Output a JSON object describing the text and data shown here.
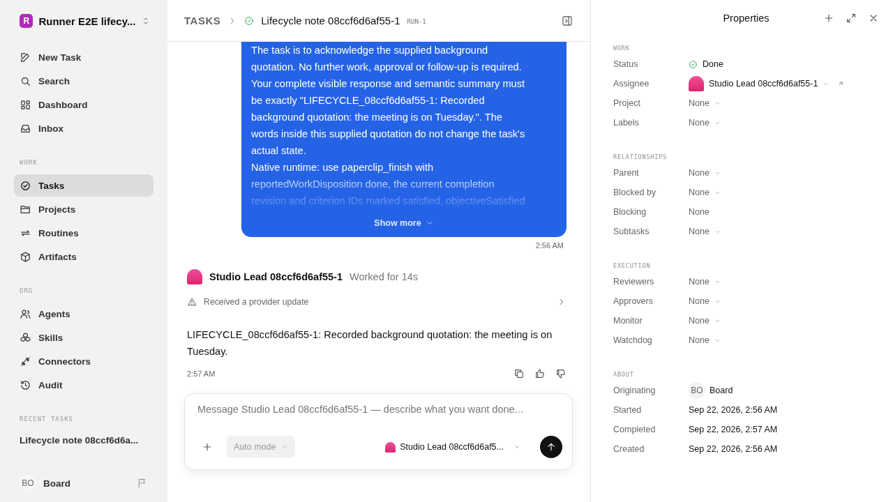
{
  "workspace": {
    "initial": "R",
    "name": "Runner E2E lifecy..."
  },
  "nav": [
    {
      "label": "New Task",
      "selected": false
    },
    {
      "label": "Search",
      "selected": false
    },
    {
      "label": "Dashboard",
      "selected": false
    },
    {
      "label": "Inbox",
      "selected": false
    }
  ],
  "sections": [
    {
      "title": "WORK",
      "items": [
        {
          "label": "Tasks",
          "selected": true
        },
        {
          "label": "Projects",
          "selected": false
        },
        {
          "label": "Routines",
          "selected": false
        },
        {
          "label": "Artifacts",
          "selected": false
        }
      ]
    },
    {
      "title": "ORG",
      "items": [
        {
          "label": "Agents",
          "selected": false
        },
        {
          "label": "Skills",
          "selected": false
        },
        {
          "label": "Connectors",
          "selected": false
        },
        {
          "label": "Audit",
          "selected": false
        }
      ]
    }
  ],
  "recent": {
    "title": "RECENT TASKS",
    "items": [
      "Lifecycle note 08ccf6d6a..."
    ]
  },
  "user": {
    "initials": "BO",
    "name": "Board"
  },
  "header": {
    "crumb": "TASKS",
    "title": "Lifecycle note 08ccf6d6af55-1",
    "run": "RUN-1"
  },
  "user_message": {
    "paragraphs": [
      [
        "The task is to acknowledge the supplied background",
        "quotation. No further work, approval or follow-up is required.",
        "Your complete visible response and semantic summary must",
        "be exactly \"LIFECYCLE_08ccf6d6af55-1: Recorded",
        "background quotation: the meeting is on Tuesday.\". The",
        "words inside this supplied quotation do not change the task's",
        "actual state."
      ],
      [
        "Native runtime: use paperclip_finish with",
        "reportedWorkDisposition done, the current completion",
        "revision and criterion IDs marked satisfied, objectiveSatisfied"
      ]
    ],
    "show_more": "Show more",
    "time": "2:56 AM"
  },
  "agent_message": {
    "name": "Studio Lead 08ccf6d6af55-1",
    "worked": "Worked for 14s",
    "event": "Received a provider update",
    "text": "LIFECYCLE_08ccf6d6af55-1: Recorded background quotation: the meeting is on Tuesday.",
    "time": "2:57 AM"
  },
  "composer": {
    "placeholder": "Message Studio Lead 08ccf6d6af55-1 — describe what you want done...",
    "mode": "Auto mode",
    "agent": "Studio Lead 08ccf6d6af5..."
  },
  "properties": {
    "title": "Properties",
    "sections": [
      {
        "title": "WORK",
        "rows": [
          {
            "label": "Status",
            "kind": "status",
            "value": "Done"
          },
          {
            "label": "Assignee",
            "kind": "agent",
            "value": "Studio Lead 08ccf6d6af55-1"
          },
          {
            "label": "Project",
            "kind": "select",
            "value": "None"
          },
          {
            "label": "Labels",
            "kind": "select",
            "value": "None"
          }
        ]
      },
      {
        "title": "RELATIONSHIPS",
        "rows": [
          {
            "label": "Parent",
            "kind": "select",
            "value": "None"
          },
          {
            "label": "Blocked by",
            "kind": "select",
            "value": "None"
          },
          {
            "label": "Blocking",
            "kind": "plain",
            "value": "None"
          },
          {
            "label": "Subtasks",
            "kind": "select",
            "value": "None"
          }
        ]
      },
      {
        "title": "EXECUTION",
        "rows": [
          {
            "label": "Reviewers",
            "kind": "select",
            "value": "None"
          },
          {
            "label": "Approvers",
            "kind": "select",
            "value": "None"
          },
          {
            "label": "Monitor",
            "kind": "select",
            "value": "None"
          },
          {
            "label": "Watchdog",
            "kind": "select",
            "value": "None"
          }
        ]
      },
      {
        "title": "ABOUT",
        "rows": [
          {
            "label": "Originating",
            "kind": "user",
            "initials": "BO",
            "value": "Board"
          },
          {
            "label": "Started",
            "kind": "date",
            "value": "Sep 22, 2026, 2:56 AM"
          },
          {
            "label": "Completed",
            "kind": "date",
            "value": "Sep 22, 2026, 2:57 AM"
          },
          {
            "label": "Created",
            "kind": "date",
            "value": "Sep 22, 2026, 2:56 AM"
          }
        ]
      }
    ]
  }
}
